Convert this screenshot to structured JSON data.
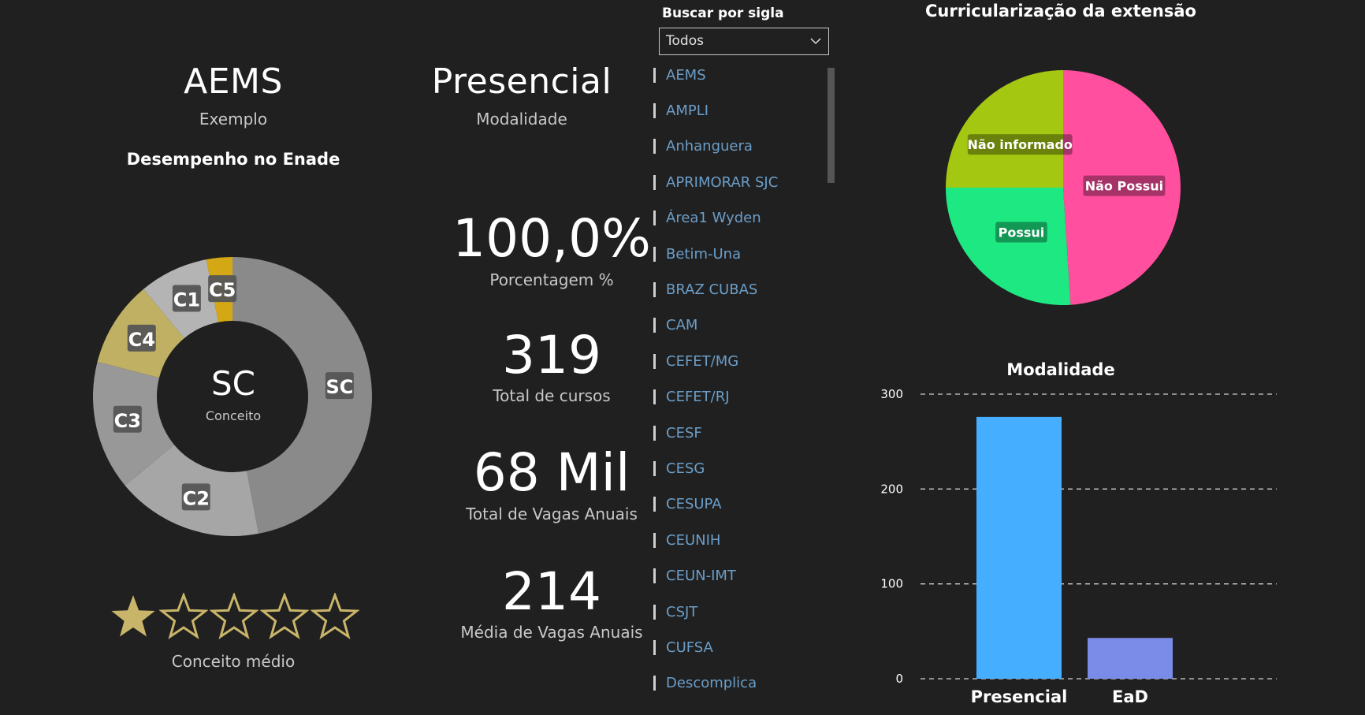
{
  "left": {
    "name": "AEMS",
    "name_sub": "Exemplo",
    "enade_title": "Desempenho no Enade",
    "center_value": "SC",
    "center_label": "Conceito",
    "rating_label": "Conceito médio",
    "rating": {
      "value": 1,
      "max": 5,
      "filled_color": "#c9b56a",
      "empty_color": "#c9b56a"
    }
  },
  "middle": {
    "modality": "Presencial",
    "modality_sub": "Modalidade",
    "kpis": [
      {
        "value": "100,0%",
        "label": "Porcentagem %"
      },
      {
        "value": "319",
        "label": "Total de cursos"
      },
      {
        "value": "68 Mil",
        "label": "Total de Vagas Anuais"
      },
      {
        "value": "214",
        "label": "Média de Vagas Anuais"
      }
    ]
  },
  "slicer": {
    "title": "Buscar por sigla",
    "selected": "Todos",
    "items": [
      "AEMS",
      "AMPLI",
      "Anhanguera",
      "APRIMORAR SJC",
      "Área1 Wyden",
      "Betim-Una",
      "BRAZ CUBAS",
      "CAM",
      "CEFET/MG",
      "CEFET/RJ",
      "CESF",
      "CESG",
      "CESUPA",
      "CEUNIH",
      "CEUN-IMT",
      "CSJT",
      "CUFSA",
      "Descomplica"
    ],
    "item_color": "#6b9ec9"
  },
  "right": {
    "pie_title": "Curricularização da extensão",
    "bar_title": "Modalidade"
  },
  "chart_data": [
    {
      "type": "pie",
      "variant": "donut",
      "title": "Desempenho no Enade",
      "categories": [
        "SC",
        "C2",
        "C3",
        "C4",
        "C1",
        "C5"
      ],
      "values": [
        47,
        17,
        15,
        10,
        8,
        3
      ],
      "colors": [
        "#8a8a8a",
        "#a6a6a6",
        "#989898",
        "#bfb063",
        "#b4b4b4",
        "#d4a814"
      ]
    },
    {
      "type": "pie",
      "title": "Curricularização da extensão",
      "categories": [
        "Não Possui",
        "Possui",
        "Não informado"
      ],
      "values": [
        49,
        26,
        25
      ],
      "colors": [
        "#ff4f9e",
        "#1ee882",
        "#a4c711"
      ]
    },
    {
      "type": "bar",
      "title": "Modalidade",
      "categories": [
        "Presencial",
        "EaD"
      ],
      "values": [
        276,
        43
      ],
      "colors": [
        "#45aeff",
        "#7a8ce8"
      ],
      "ylim": [
        0,
        300
      ],
      "yticks": [
        0,
        100,
        200,
        300
      ],
      "grid": true
    }
  ]
}
